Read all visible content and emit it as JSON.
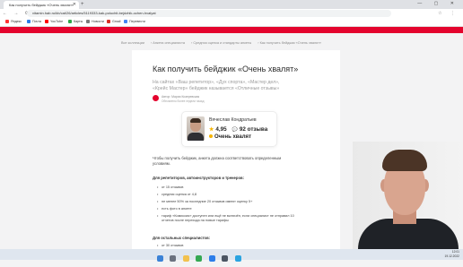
{
  "browser": {
    "tab_title": "Как получить бейджик «Очень хвалят»",
    "url": "vitamin.hab.ru/kb/cat/26/articles/5119333-kak-poluchit-bejdzhik-ochen-hvalyat",
    "bookmarks": [
      {
        "label": "Яндекс",
        "color": "#ff3333"
      },
      {
        "label": "Почта",
        "color": "#2b7de9"
      },
      {
        "label": "YouTube",
        "color": "#ff0000"
      },
      {
        "label": "Карты",
        "color": "#2ea84a"
      },
      {
        "label": "Новости",
        "color": "#7a7a7a"
      },
      {
        "label": "Gmail",
        "color": "#d93025"
      },
      {
        "label": "Перевести",
        "color": "#4285f4"
      }
    ]
  },
  "colors": {
    "brand_red": "#e4032d",
    "star": "#f5b400"
  },
  "breadcrumb": [
    "Все коллекции",
    "Анкета специалиста",
    "Средняя оценка и стандарты анкеты",
    "Как получить бейджик «Очень хвалят»"
  ],
  "article": {
    "title": "Как получить бейджик «Очень хвалят»",
    "lead": "На сайтах «Ваш репетитор», «Дух спорта», «Мастер дел», «Крейс Мастер» бейджик называется «Отличные отзывы»",
    "author_line1": "Автор: Мария Кизеревская",
    "author_line2": "Обновлено более недели назад",
    "badge": {
      "name": "Вячеслав Кондратьев",
      "rating": "4,95",
      "reviews": "92 отзыва",
      "praise": "Очень хвалят"
    },
    "intro": "Чтобы получить бейджик, анкета должна соответствовать определенным условиям.",
    "section1_title": "Для репетиторов, автоинструкторов и тренеров:",
    "section1_items": [
      "от 15 отзывов",
      "средняя оценка от 4,8",
      "не менее 50% за последние 20 отзывов имеют оценку 5+",
      "есть фото в анкете",
      "тариф «Комиссия» доступен или ещё не включён, если специалист не отправил 10 отчетов после перехода на новые тарифы"
    ],
    "section2_title": "Для остальных специалистов:",
    "section2_items": [
      "от 30 отзывов"
    ]
  },
  "taskbar": {
    "time": "12:01",
    "date": "19.12.2022",
    "icons": [
      {
        "name": "start-icon",
        "color": "#3b82d6"
      },
      {
        "name": "search-icon",
        "color": "#6b7280"
      },
      {
        "name": "explorer-icon",
        "color": "#f2c14e"
      },
      {
        "name": "chrome-icon",
        "color": "#34a853"
      },
      {
        "name": "mail-icon",
        "color": "#2b7de9"
      },
      {
        "name": "store-icon",
        "color": "#4b5563"
      },
      {
        "name": "telegram-icon",
        "color": "#2aa3e0"
      }
    ]
  }
}
